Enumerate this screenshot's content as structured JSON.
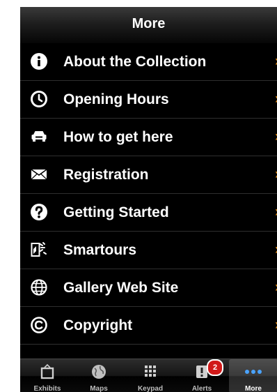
{
  "nav_bar": {
    "title": "More"
  },
  "menu": {
    "items": [
      {
        "label": "About the Collection",
        "icon": "info-icon"
      },
      {
        "label": "Opening Hours",
        "icon": "clock-icon"
      },
      {
        "label": "How to get here",
        "icon": "car-icon"
      },
      {
        "label": "Registration",
        "icon": "envelope-icon"
      },
      {
        "label": "Getting Started",
        "icon": "question-icon"
      },
      {
        "label": "Smartours",
        "icon": "smartours-icon"
      },
      {
        "label": "Gallery Web Site",
        "icon": "globe-icon"
      },
      {
        "label": "Copyright",
        "icon": "copyright-icon"
      }
    ],
    "chevron": "›",
    "chevron_color": "#e08a12"
  },
  "tab_bar": {
    "tabs": [
      {
        "label": "Exhibits",
        "icon": "frame-icon"
      },
      {
        "label": "Maps",
        "icon": "globe-icon"
      },
      {
        "label": "Keypad",
        "icon": "keypad-icon"
      },
      {
        "label": "Alerts",
        "icon": "alert-icon",
        "badge": "2"
      },
      {
        "label": "More",
        "icon": "more-dots-icon",
        "selected": true
      }
    ]
  }
}
